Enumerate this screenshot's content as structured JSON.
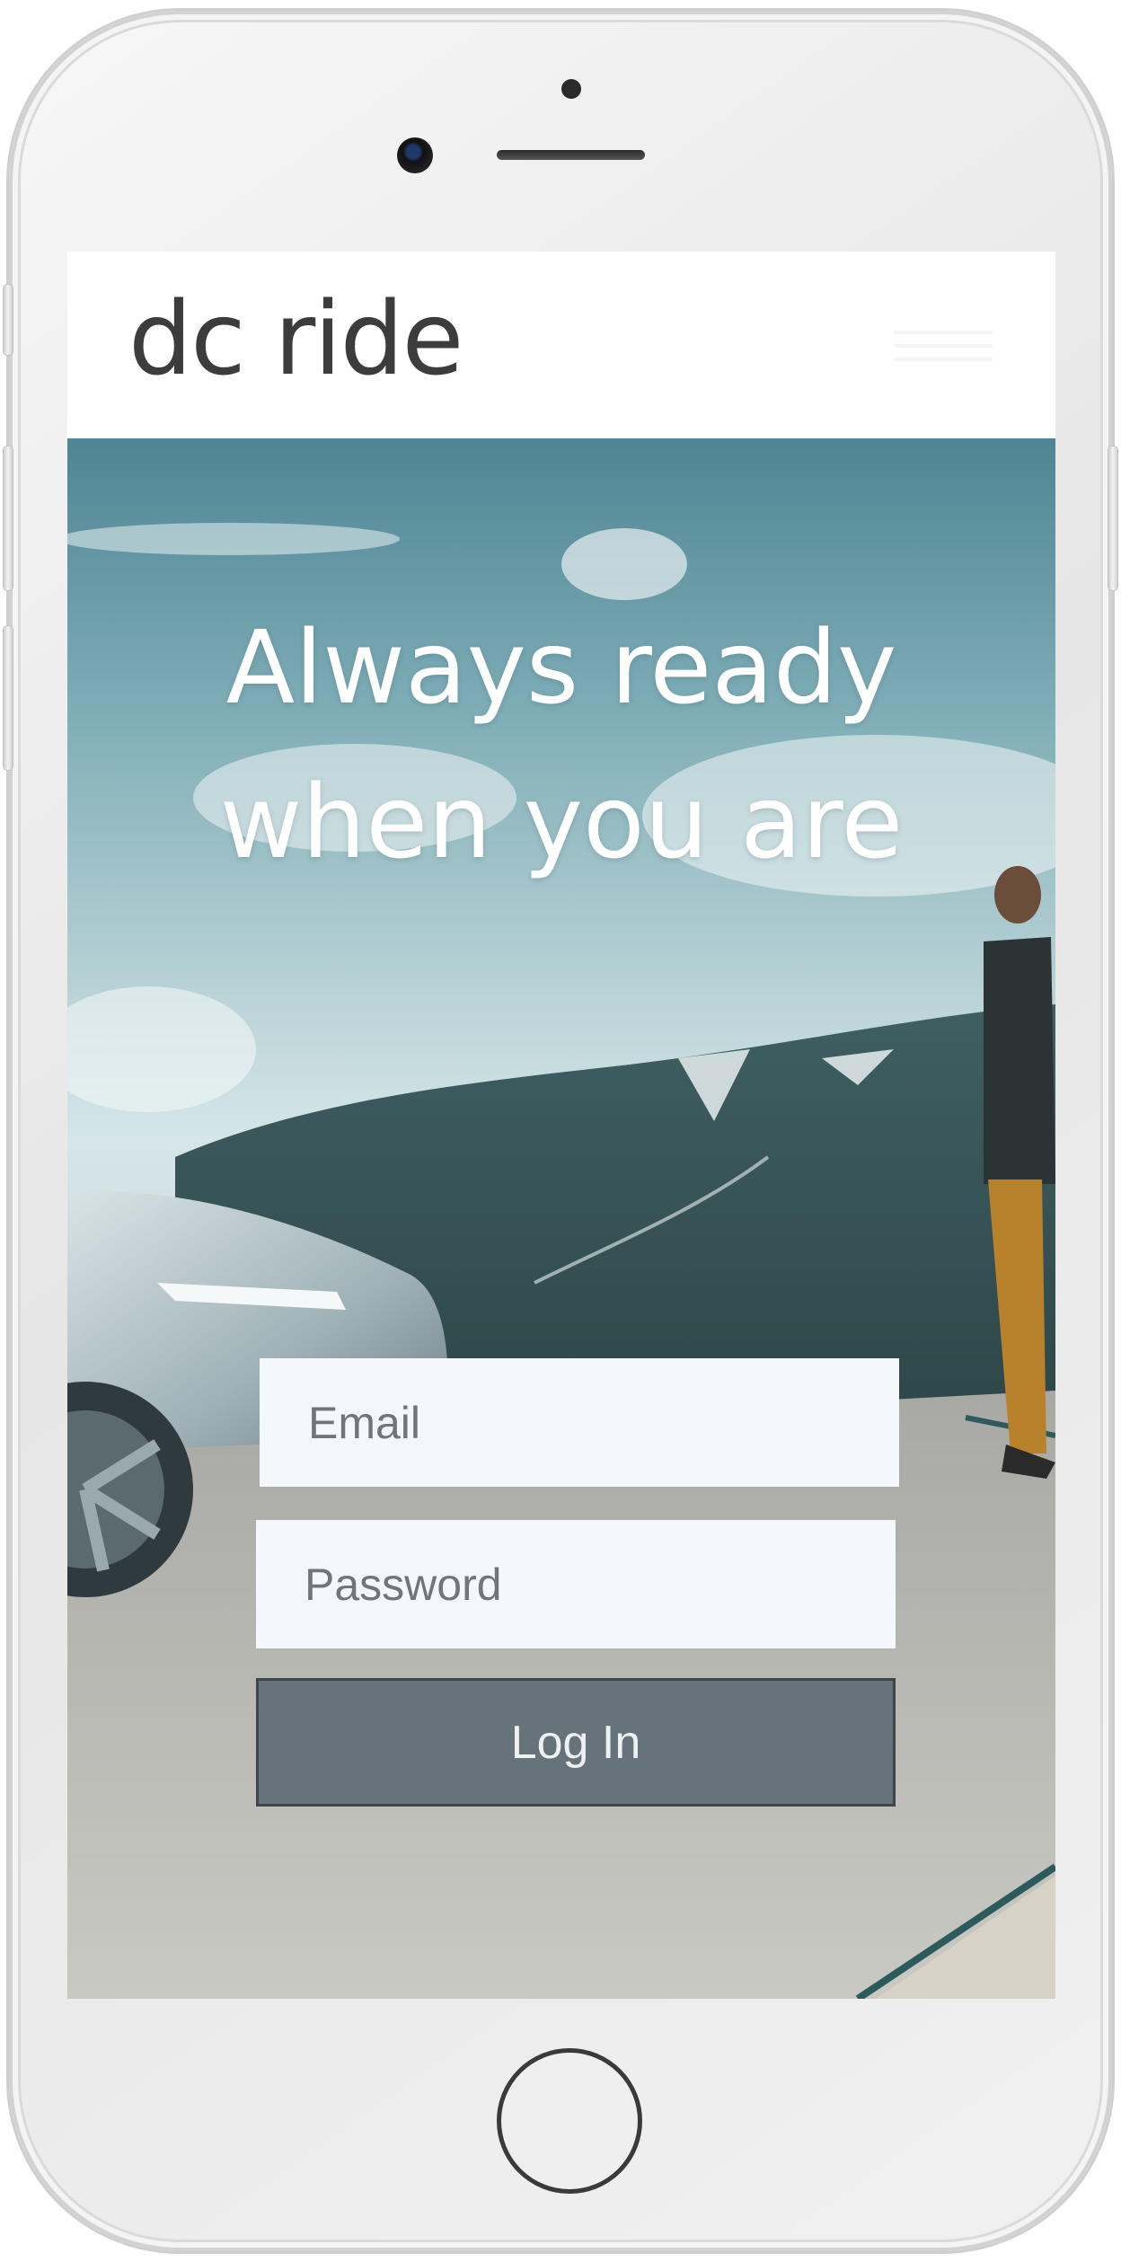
{
  "header": {
    "logo_text": "dc ride"
  },
  "hero": {
    "headline_line1": "Always ready",
    "headline_line2": "when you are"
  },
  "login": {
    "email_placeholder": "Email",
    "password_placeholder": "Password",
    "login_button": "Log In"
  },
  "colors": {
    "button_bg": "#66737b",
    "input_bg": "#f4f7fb",
    "headline": "#ffffff",
    "logo": "#3c3c3c"
  },
  "icons": {
    "menu": "hamburger-menu-icon"
  }
}
